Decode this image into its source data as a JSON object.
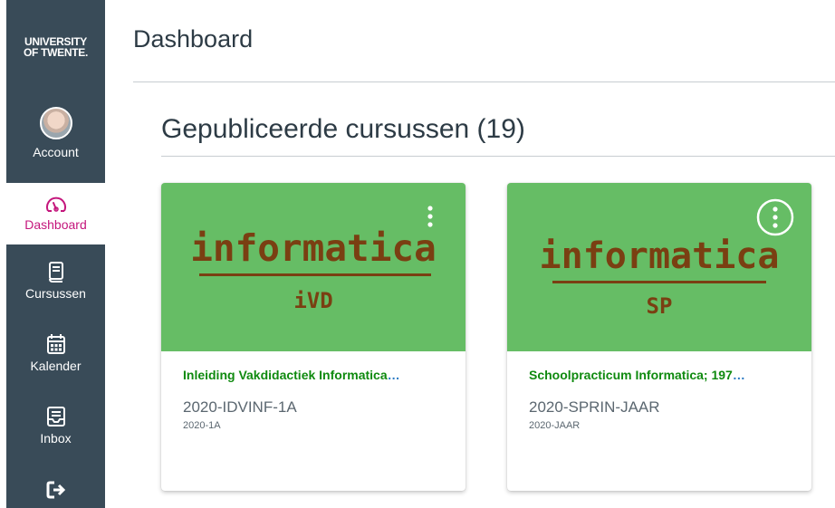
{
  "sidebar": {
    "logo_line1": "UNIVERSITY",
    "logo_line2": "OF TWENTE.",
    "items": [
      {
        "label": "Account",
        "icon": "avatar"
      },
      {
        "label": "Dashboard",
        "icon": "dashboard-icon",
        "active": true
      },
      {
        "label": "Cursussen",
        "icon": "book-icon"
      },
      {
        "label": "Kalender",
        "icon": "calendar-icon"
      },
      {
        "label": "Inbox",
        "icon": "inbox-icon"
      },
      {
        "label": "",
        "icon": "logout-icon"
      }
    ]
  },
  "main": {
    "title": "Dashboard",
    "section_title": "Gepubliceerde cursussen (19)",
    "cards": [
      {
        "hero_word": "informatica",
        "hero_sub": "iVD",
        "name": "Inleiding Vakdidactiek Informatica",
        "code": "2020-IDVINF-1A",
        "term": "2020-1A",
        "hero_color": "#66bd65"
      },
      {
        "hero_word": "informatica",
        "hero_sub": "SP",
        "name": "Schoolpracticum Informatica; 197",
        "code": "2020-SPRIN-JAAR",
        "term": "2020-JAAR",
        "hero_color": "#66bd65"
      }
    ]
  },
  "colors": {
    "sidebar_bg": "#394b58",
    "active_accent": "#c4167c",
    "course_title": "#0f8a0f",
    "hero_text": "#7a3f12"
  }
}
